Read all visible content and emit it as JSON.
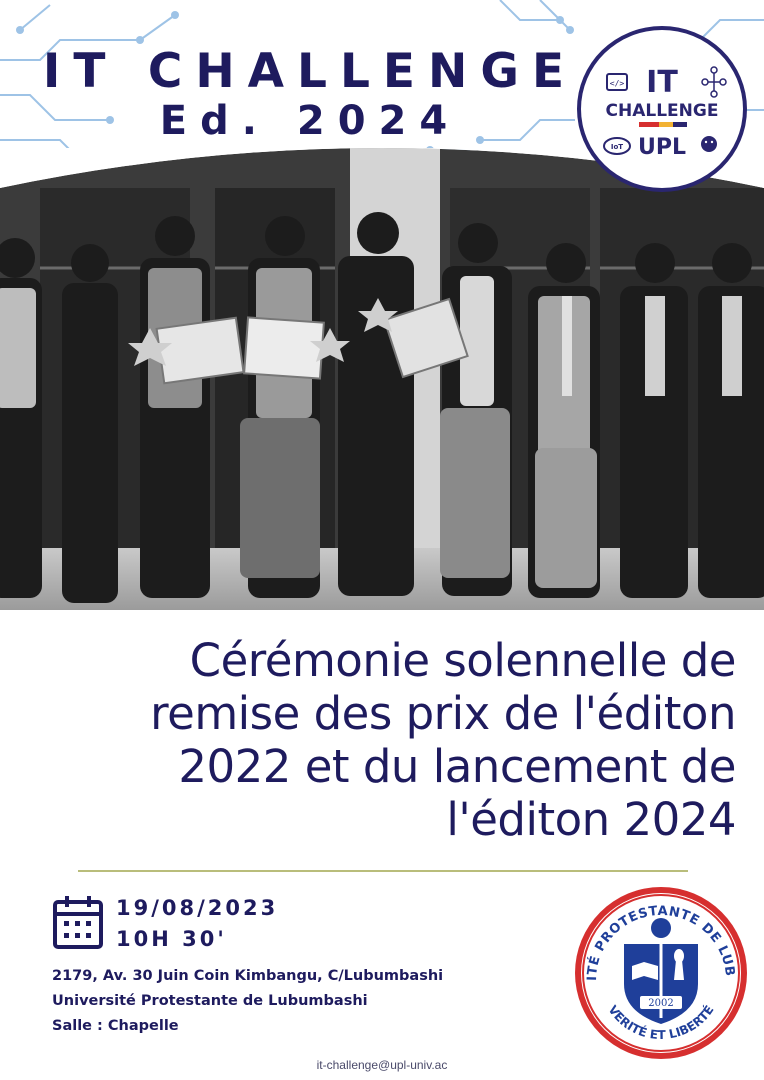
{
  "header": {
    "title_line1": "IT CHALLENGE",
    "title_line2": "Ed. 2024"
  },
  "badge": {
    "line1": "IT",
    "line2": "CHALLENGE",
    "line3": "UPL",
    "iot_label": "IoT",
    "code_label": "</>"
  },
  "photo": {
    "tone": "black-and-white",
    "subject": "group-of-award-winners"
  },
  "headline": {
    "lines": [
      "Cérémonie solennelle de",
      "remise des prix de l'éditon",
      "2022 et du lancement de",
      "l'éditon 2024"
    ]
  },
  "event": {
    "date": "19/08/2023",
    "time": "10H 30'",
    "address_line1": "2179, Av. 30 Juin Coin Kimbangu, C/Lubumbashi",
    "address_line2": "Université Protestante de Lubumbashi",
    "address_line3": "Salle : Chapelle"
  },
  "seal": {
    "ring_text": "UNIVERSITÉ PROTESTANTE DE LUBUMBASHI",
    "motto": "VERITÉ ET LIBERTÉ",
    "year": "2002"
  },
  "footer": {
    "email": "it-challenge@upl-univ.ac"
  },
  "colors": {
    "primary": "#1e1b5e",
    "seal_red": "#d62f2f",
    "seal_blue": "#1f3f9a",
    "divider": "#b9bd7b",
    "circuit": "#9ec3e6"
  }
}
